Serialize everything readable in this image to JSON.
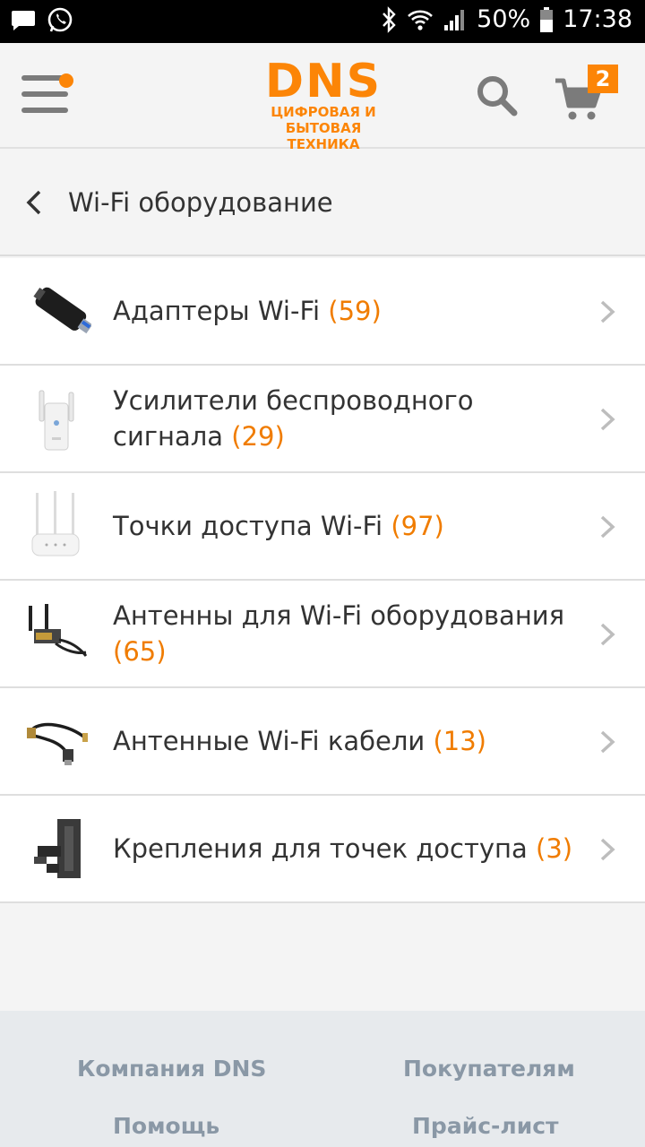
{
  "status_bar": {
    "battery": "50%",
    "time": "17:38"
  },
  "header": {
    "logo_main": "DNS",
    "logo_line1": "ЦИФРОВАЯ И",
    "logo_line2": "БЫТОВАЯ ТЕХНИКА",
    "cart_count": "2"
  },
  "page": {
    "title": "Wi-Fi оборудование"
  },
  "categories": [
    {
      "name": "Адаптеры Wi-Fi",
      "count": "(59)",
      "icon": "usb-wifi-adapter-image"
    },
    {
      "name": "Усилители беспроводного сигнала",
      "count": "(29)",
      "icon": "signal-repeater-image"
    },
    {
      "name": "Точки доступа Wi-Fi",
      "count": "(97)",
      "icon": "access-point-image"
    },
    {
      "name": "Антенны для Wi-Fi оборудования",
      "count": "(65)",
      "icon": "antenna-image"
    },
    {
      "name": "Антенные Wi-Fi кабели",
      "count": "(13)",
      "icon": "antenna-cable-image"
    },
    {
      "name": "Крепления для точек доступа",
      "count": "(3)",
      "icon": "access-point-mount-image"
    }
  ],
  "footer": {
    "links": [
      "Компания DNS",
      "Покупателям",
      "Помощь",
      "Прайс-лист"
    ]
  },
  "colors": {
    "accent": "#fc8507",
    "count": "#f07c00",
    "footer_link": "#8a98a6"
  }
}
